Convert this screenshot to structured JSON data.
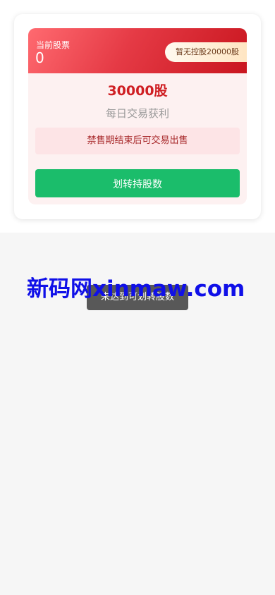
{
  "stock_card": {
    "current_label": "当前股票",
    "current_value": "0",
    "holding_badge": "暂无控股20000股",
    "amount": "30000股",
    "subtitle": "每日交易获利",
    "notice": "禁售期结束后可交易出售",
    "transfer_button": "划转持股数"
  },
  "toast": {
    "message": "未达到可划转股数"
  },
  "watermark": {
    "text": "新码网xinmaw.com"
  },
  "colors": {
    "banner_red": "#e53a45",
    "accent_red": "#cf1f23",
    "button_green": "#1bbd6b",
    "watermark_blue": "#1010e8"
  }
}
